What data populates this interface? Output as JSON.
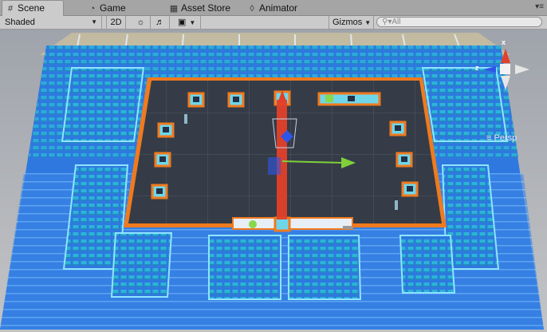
{
  "tabs": [
    {
      "label": "Scene",
      "icon": "hash-icon"
    },
    {
      "label": "Game",
      "icon": "pacman-icon"
    },
    {
      "label": "Asset Store",
      "icon": "bag-icon"
    },
    {
      "label": "Animator",
      "icon": "animator-icon"
    }
  ],
  "toolbar": {
    "shading_mode": "Shaded",
    "mode_2d": "2D",
    "lighting_icon": "sun-icon",
    "audio_icon": "speaker-icon",
    "effects_icon": "image-icon",
    "gizmos": "Gizmos",
    "search_placeholder": "All"
  },
  "gizmo": {
    "x_label": "x",
    "z_label": "z",
    "projection": "Persp"
  },
  "colors": {
    "floor": "#353c47",
    "outline": "#f07a1e",
    "seats": "#2bb4d6",
    "stands": "#2f78e0",
    "move_x": "#7fd03a",
    "move_z": "#2e55e6",
    "move_y": "#e2402a"
  }
}
